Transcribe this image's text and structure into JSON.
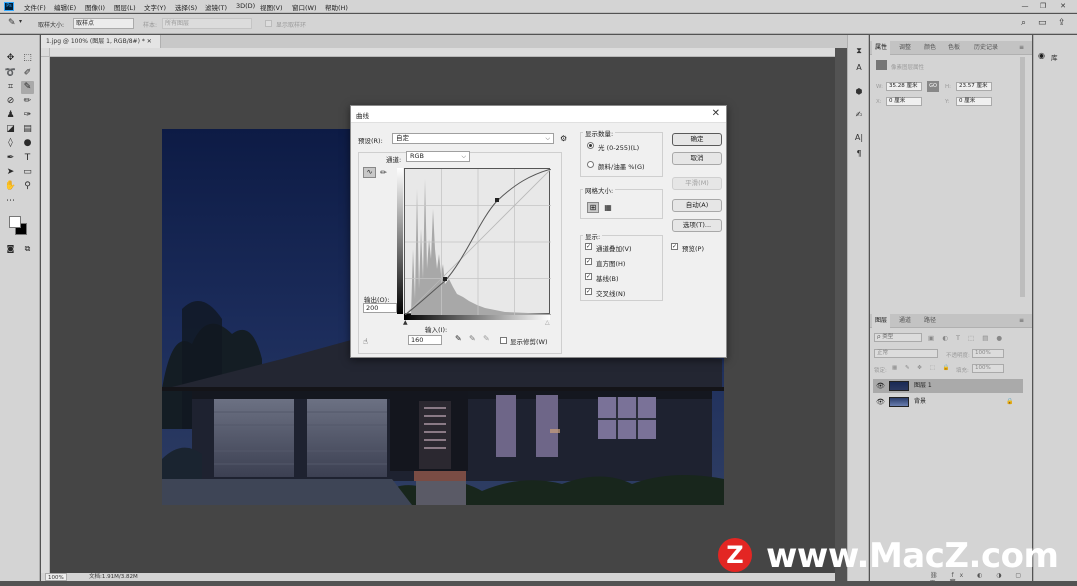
{
  "menubar": {
    "app_icon": "Ps",
    "items": [
      "文件(F)",
      "编辑(E)",
      "图像(I)",
      "图层(L)",
      "文字(Y)",
      "选择(S)",
      "滤镜(T)",
      "3D(D)",
      "视图(V)",
      "窗口(W)",
      "帮助(H)"
    ]
  },
  "options": {
    "sample_size_label": "取样大小:",
    "sample_size_value": "取样点",
    "sample_label": "样本:",
    "sample_value": "所有图层",
    "show_ring_label": "显示取样环"
  },
  "document": {
    "tab_title": "1.jpg @ 100% (图层 1, RGB/8#) *",
    "zoom": "100%",
    "doc_info": "文档:1.91M/3.82M"
  },
  "curves_dialog": {
    "title": "曲线",
    "preset_label": "预设(R):",
    "preset_value": "自定",
    "channel_label": "通道:",
    "channel_value": "RGB",
    "output_label": "输出(O):",
    "output_value": "200",
    "input_label": "输入(I):",
    "input_value": "160",
    "show_clipping_label": "显示修剪(W)",
    "display_amount": {
      "title": "显示数量:",
      "light_label": "光 (0-255)(L)",
      "pigment_label": "颜料/油墨 %(G)"
    },
    "grid_size_title": "网格大小:",
    "show": {
      "title": "显示:",
      "channel_overlays": "通道叠加(V)",
      "histogram": "直方图(H)",
      "baseline": "基线(B)",
      "intersection": "交叉线(N)"
    },
    "buttons": {
      "ok": "确定",
      "cancel": "取消",
      "smooth": "平滑(M)",
      "auto": "自动(A)",
      "options": "选项(T)..."
    },
    "preview_label": "预览(P)"
  },
  "properties_panel": {
    "tabs": [
      "属性",
      "调整",
      "颜色",
      "色板",
      "历史记录"
    ],
    "subtitle": "像素图层属性",
    "w_label": "W:",
    "w_value": "35.28 厘米",
    "h_label": "H:",
    "h_value": "23.57 厘米",
    "x_label": "X:",
    "x_value": "0 厘米",
    "y_label": "Y:",
    "y_value": "0 厘米",
    "link_label": "GO"
  },
  "layers_panel": {
    "tabs": [
      "图层",
      "通道",
      "路径"
    ],
    "filter_value": "ρ 类型",
    "blend_mode": "正常",
    "opacity_label": "不透明度:",
    "opacity_value": "100%",
    "lock_label": "锁定:",
    "fill_label": "填充:",
    "fill_value": "100%",
    "layers": [
      {
        "name": "图层 1",
        "selected": true
      },
      {
        "name": "背景",
        "selected": false
      }
    ]
  },
  "libraries_label": "库",
  "watermark": {
    "logo_letter": "Z",
    "text": "www.MacZ.com"
  }
}
